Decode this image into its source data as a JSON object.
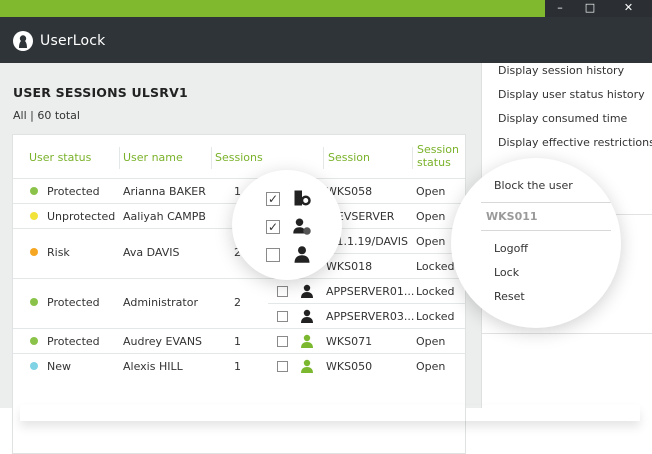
{
  "app": {
    "name": "UserLock",
    "logo_icon": "userlock-logo-icon"
  },
  "window_controls": {
    "minimize": "–",
    "maximize": "□",
    "close": "✕"
  },
  "colors": {
    "accent": "#80b82e",
    "header_bg": "#2f3438",
    "protected": "#8bc34a",
    "unprotected": "#ffeb3b",
    "risk": "#f5a623",
    "new": "#7fd3e5"
  },
  "page": {
    "title": "USER SESSIONS ULSRV1",
    "filter": "All | 60 total"
  },
  "table": {
    "columns": [
      "User status",
      "User name",
      "Sessions",
      "Session",
      "Session status"
    ],
    "session_status_header_line1": "Session",
    "session_status_header_line2": "status",
    "users": [
      {
        "status": "Protected",
        "name": "Arianna BAKER",
        "sessions": "1"
      },
      {
        "status": "Unprotected",
        "name": "Aaliyah CAMPB",
        "sessions": ""
      },
      {
        "status": "Risk",
        "name": "Ava DAVIS",
        "sessions": "2"
      },
      {
        "status": "Protected",
        "name": "Administrator",
        "sessions": "2"
      },
      {
        "status": "Protected",
        "name": "Audrey EVANS",
        "sessions": "1"
      },
      {
        "status": "New",
        "name": "Alexis HILL",
        "sessions": "1"
      }
    ],
    "sessions": [
      {
        "session": "WKS058",
        "status": "Open",
        "checked": false,
        "icon": "user-green-icon"
      },
      {
        "session": "WEVSERVER",
        "status": "Open",
        "checked": true,
        "icon": "terminal-server-icon"
      },
      {
        "session": "1.1.1.19/DAVIS",
        "status": "Open",
        "checked": true,
        "icon": "remote-user-icon"
      },
      {
        "session": "WKS018",
        "status": "Locked",
        "checked": false,
        "icon": "user-black-icon"
      },
      {
        "session": "APPSERVER01...",
        "status": "Locked",
        "checked": false,
        "icon": "user-black-icon"
      },
      {
        "session": "APPSERVER03...",
        "status": "Locked",
        "checked": false,
        "icon": "user-black-icon"
      },
      {
        "session": "WKS071",
        "status": "Open",
        "checked": false,
        "icon": "user-green-icon"
      },
      {
        "session": "WKS050",
        "status": "Open",
        "checked": false,
        "icon": "user-green-icon"
      }
    ]
  },
  "side_menu": {
    "items": [
      "Display session history",
      "Display user status history",
      "Display consumed time",
      "Display effective restrictions"
    ]
  },
  "context_menu": {
    "top_item": "Block the user",
    "section_label": "WKS011",
    "items": [
      "Logoff",
      "Lock",
      "Reset"
    ]
  }
}
